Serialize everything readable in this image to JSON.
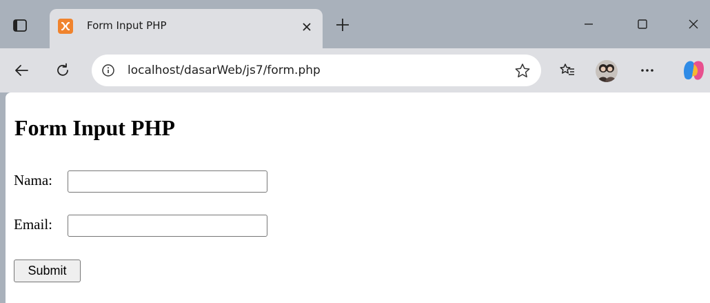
{
  "browser": {
    "tab": {
      "title": "Form Input PHP",
      "icon": "xampp-icon"
    },
    "new_tab_icon": "plus-icon",
    "window_controls": [
      "minimize-icon",
      "maximize-icon",
      "close-icon"
    ],
    "address_bar": {
      "url": "localhost/dasarWeb/js7/form.php"
    },
    "toolbar_icons": [
      "back-icon",
      "refresh-icon",
      "info-icon",
      "star-icon",
      "favorites-icon",
      "avatar",
      "more-icon",
      "copilot-icon"
    ]
  },
  "page": {
    "title": "Form Input PHP",
    "fields": [
      {
        "label": "Nama:",
        "value": ""
      },
      {
        "label": "Email:",
        "value": ""
      }
    ],
    "submit_label": "Submit"
  },
  "colors": {
    "titlebar": "#a9b1bb",
    "toolbar": "#dedfe3",
    "tab_icon": "#f0832d"
  }
}
